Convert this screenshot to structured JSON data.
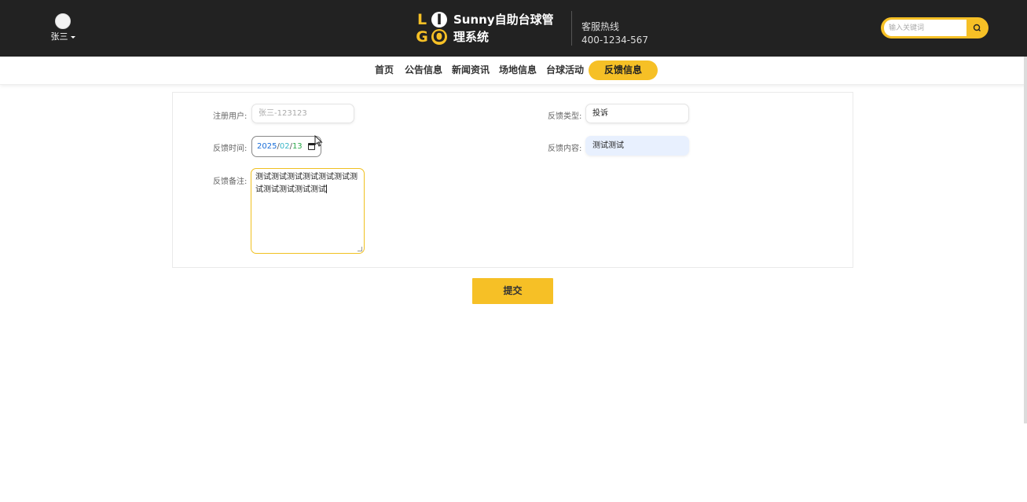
{
  "header": {
    "user_name": "张三",
    "logo_letters": [
      "L",
      "I",
      "G",
      "O"
    ],
    "site_title": "Sunny自助台球管理系统",
    "hotline_label": "客服热线",
    "hotline_number": "400-1234-567",
    "search_placeholder": "输入关键词",
    "icons": {
      "search": "search-icon",
      "user": "user-avatar",
      "dropdown": "caret-down-icon"
    },
    "accent_color": "#f6c026",
    "bg_color": "#222222"
  },
  "nav": {
    "items": [
      {
        "label": "首页"
      },
      {
        "label": "公告信息"
      },
      {
        "label": "新闻资讯"
      },
      {
        "label": "场地信息"
      },
      {
        "label": "台球活动"
      },
      {
        "label": "反馈信息",
        "active": true
      }
    ]
  },
  "form": {
    "registered_user": {
      "label": "注册用户:",
      "value": "张三-123123"
    },
    "feedback_type": {
      "label": "反馈类型:",
      "value": "投诉"
    },
    "feedback_time": {
      "label": "反馈时间:",
      "year": "2025",
      "month": "02",
      "day": "13",
      "sep": "/"
    },
    "feedback_content": {
      "label": "反馈内容:",
      "value": "测试测试"
    },
    "feedback_note": {
      "label": "反馈备注:",
      "value": "测试测试测试测试测试测试测试测试测试测试测试"
    },
    "submit_label": "提交"
  }
}
